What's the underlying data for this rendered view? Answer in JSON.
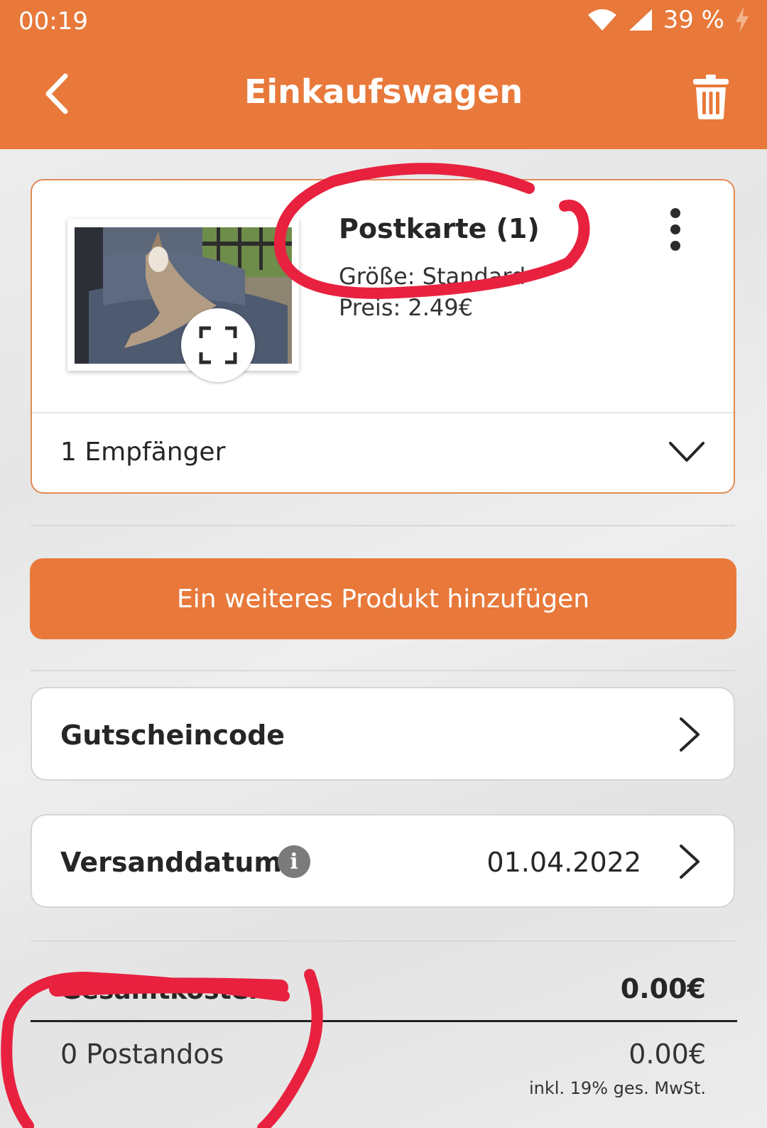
{
  "status_bar": {
    "time": "00:19",
    "battery": "39 %"
  },
  "app_bar": {
    "title": "Einkaufswagen"
  },
  "product": {
    "title": "Postkarte (1)",
    "size": "Größe: Standard",
    "price": "Preis: 2.49€",
    "recipients": "1 Empfänger"
  },
  "add_product_label": "Ein weiteres Produkt hinzufügen",
  "voucher": {
    "label": "Gutscheincode"
  },
  "shipping": {
    "label": "Versanddatum",
    "info_icon": "i",
    "date": "01.04.2022"
  },
  "totals": {
    "label": "Gesamtkosten",
    "value": "0.00€",
    "postandos_label": "0 Postandos",
    "postandos_value": "0.00€",
    "tax_note": "inkl. 19% ges. MwSt."
  },
  "colors": {
    "accent": "#e8793a",
    "annotation": "#e8213f"
  }
}
